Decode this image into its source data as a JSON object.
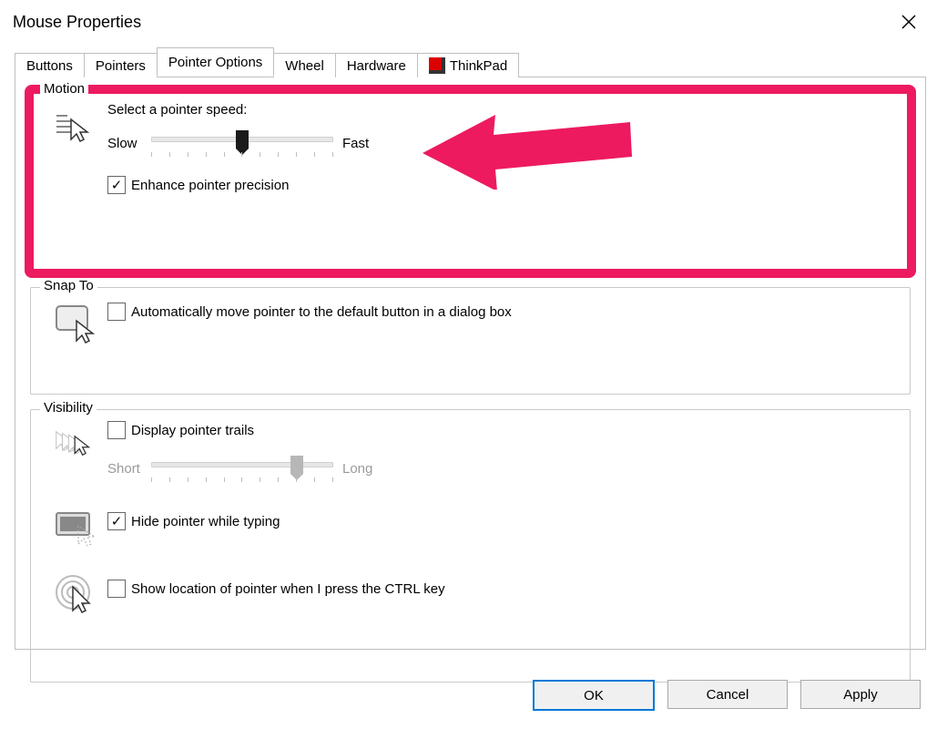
{
  "title": "Mouse Properties",
  "tabs": [
    "Buttons",
    "Pointers",
    "Pointer Options",
    "Wheel",
    "Hardware",
    "ThinkPad"
  ],
  "active_tab": 2,
  "motion": {
    "legend": "Motion",
    "label": "Select a pointer speed:",
    "slow": "Slow",
    "fast": "Fast",
    "slider_position_pct": 50,
    "enhance_checked": true,
    "enhance": "Enhance pointer precision"
  },
  "snapto": {
    "legend": "Snap To",
    "checked": false,
    "label": "Automatically move pointer to the default button in a dialog box"
  },
  "visibility": {
    "legend": "Visibility",
    "trails_checked": false,
    "trails": "Display pointer trails",
    "short": "Short",
    "long": "Long",
    "trails_slider_pct": 80,
    "hide_checked": true,
    "hide": "Hide pointer while typing",
    "ctrl_checked": false,
    "ctrl": "Show location of pointer when I press the CTRL key"
  },
  "buttons": {
    "ok": "OK",
    "cancel": "Cancel",
    "apply": "Apply"
  },
  "colors": {
    "accent": "#0078d7",
    "highlight": "#ed1a60"
  }
}
